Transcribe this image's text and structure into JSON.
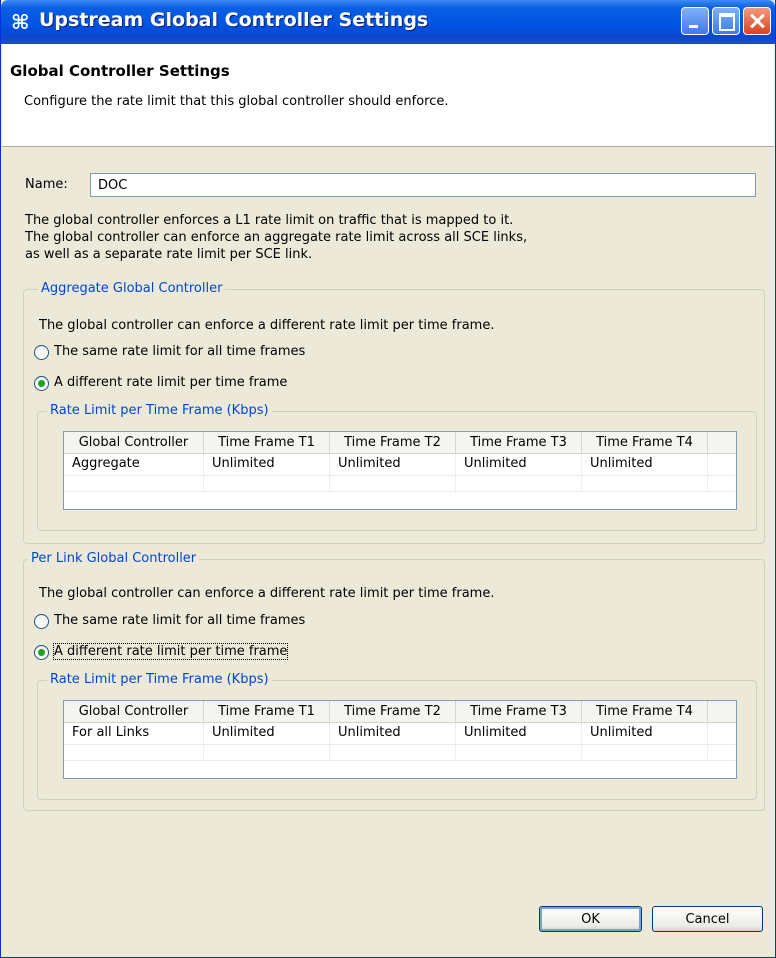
{
  "window": {
    "title": "Upstream Global Controller Settings",
    "icon": "controller-icon"
  },
  "header": {
    "title": "Global Controller Settings",
    "description": "Configure the rate limit that this global controller should enforce."
  },
  "name_field": {
    "label": "Name:",
    "value": "DOC"
  },
  "intro": [
    "The global controller enforces a L1 rate limit on traffic that is mapped to it.",
    "The global controller can enforce an aggregate rate limit across all SCE links,",
    "as well as a separate rate limit per SCE link."
  ],
  "aggregate_group": {
    "legend": "Aggregate Global Controller",
    "description": "The global controller can enforce a different rate limit per time frame.",
    "options": [
      {
        "label": "The same rate limit for all time frames",
        "selected": false
      },
      {
        "label": "A different rate limit per time frame",
        "selected": true
      }
    ],
    "rate_group": {
      "legend": "Rate Limit per Time Frame (Kbps)",
      "columns": [
        "Global Controller",
        "Time Frame T1",
        "Time Frame T2",
        "Time Frame T3",
        "Time Frame T4"
      ],
      "rows": [
        [
          "Aggregate",
          "Unlimited",
          "Unlimited",
          "Unlimited",
          "Unlimited"
        ]
      ]
    }
  },
  "per_link_group": {
    "legend": "Per Link Global Controller",
    "description": "The global controller can enforce a different rate limit per time frame.",
    "options": [
      {
        "label": "The same rate limit for all time frames",
        "selected": false
      },
      {
        "label": "A different rate limit per time frame",
        "selected": true
      }
    ],
    "rate_group": {
      "legend": "Rate Limit per Time Frame (Kbps)",
      "columns": [
        "Global Controller",
        "Time Frame T1",
        "Time Frame T2",
        "Time Frame T3",
        "Time Frame T4"
      ],
      "rows": [
        [
          "For all Links",
          "Unlimited",
          "Unlimited",
          "Unlimited",
          "Unlimited"
        ]
      ]
    }
  },
  "buttons": {
    "ok": "OK",
    "cancel": "Cancel"
  }
}
